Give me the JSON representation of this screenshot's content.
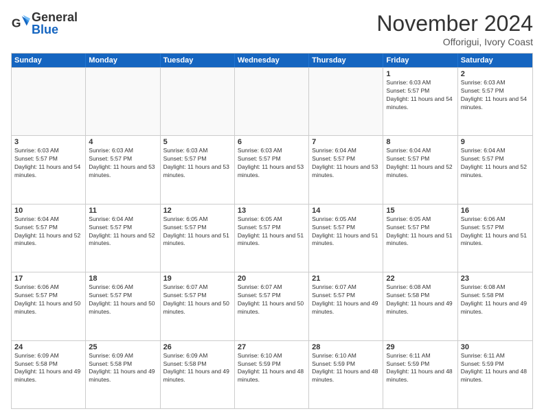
{
  "logo": {
    "general": "General",
    "blue": "Blue"
  },
  "header": {
    "month": "November 2024",
    "location": "Offorigui, Ivory Coast"
  },
  "weekdays": [
    "Sunday",
    "Monday",
    "Tuesday",
    "Wednesday",
    "Thursday",
    "Friday",
    "Saturday"
  ],
  "weeks": [
    [
      {
        "day": "",
        "info": ""
      },
      {
        "day": "",
        "info": ""
      },
      {
        "day": "",
        "info": ""
      },
      {
        "day": "",
        "info": ""
      },
      {
        "day": "",
        "info": ""
      },
      {
        "day": "1",
        "info": "Sunrise: 6:03 AM\nSunset: 5:57 PM\nDaylight: 11 hours and 54 minutes."
      },
      {
        "day": "2",
        "info": "Sunrise: 6:03 AM\nSunset: 5:57 PM\nDaylight: 11 hours and 54 minutes."
      }
    ],
    [
      {
        "day": "3",
        "info": "Sunrise: 6:03 AM\nSunset: 5:57 PM\nDaylight: 11 hours and 54 minutes."
      },
      {
        "day": "4",
        "info": "Sunrise: 6:03 AM\nSunset: 5:57 PM\nDaylight: 11 hours and 53 minutes."
      },
      {
        "day": "5",
        "info": "Sunrise: 6:03 AM\nSunset: 5:57 PM\nDaylight: 11 hours and 53 minutes."
      },
      {
        "day": "6",
        "info": "Sunrise: 6:03 AM\nSunset: 5:57 PM\nDaylight: 11 hours and 53 minutes."
      },
      {
        "day": "7",
        "info": "Sunrise: 6:04 AM\nSunset: 5:57 PM\nDaylight: 11 hours and 53 minutes."
      },
      {
        "day": "8",
        "info": "Sunrise: 6:04 AM\nSunset: 5:57 PM\nDaylight: 11 hours and 52 minutes."
      },
      {
        "day": "9",
        "info": "Sunrise: 6:04 AM\nSunset: 5:57 PM\nDaylight: 11 hours and 52 minutes."
      }
    ],
    [
      {
        "day": "10",
        "info": "Sunrise: 6:04 AM\nSunset: 5:57 PM\nDaylight: 11 hours and 52 minutes."
      },
      {
        "day": "11",
        "info": "Sunrise: 6:04 AM\nSunset: 5:57 PM\nDaylight: 11 hours and 52 minutes."
      },
      {
        "day": "12",
        "info": "Sunrise: 6:05 AM\nSunset: 5:57 PM\nDaylight: 11 hours and 51 minutes."
      },
      {
        "day": "13",
        "info": "Sunrise: 6:05 AM\nSunset: 5:57 PM\nDaylight: 11 hours and 51 minutes."
      },
      {
        "day": "14",
        "info": "Sunrise: 6:05 AM\nSunset: 5:57 PM\nDaylight: 11 hours and 51 minutes."
      },
      {
        "day": "15",
        "info": "Sunrise: 6:05 AM\nSunset: 5:57 PM\nDaylight: 11 hours and 51 minutes."
      },
      {
        "day": "16",
        "info": "Sunrise: 6:06 AM\nSunset: 5:57 PM\nDaylight: 11 hours and 51 minutes."
      }
    ],
    [
      {
        "day": "17",
        "info": "Sunrise: 6:06 AM\nSunset: 5:57 PM\nDaylight: 11 hours and 50 minutes."
      },
      {
        "day": "18",
        "info": "Sunrise: 6:06 AM\nSunset: 5:57 PM\nDaylight: 11 hours and 50 minutes."
      },
      {
        "day": "19",
        "info": "Sunrise: 6:07 AM\nSunset: 5:57 PM\nDaylight: 11 hours and 50 minutes."
      },
      {
        "day": "20",
        "info": "Sunrise: 6:07 AM\nSunset: 5:57 PM\nDaylight: 11 hours and 50 minutes."
      },
      {
        "day": "21",
        "info": "Sunrise: 6:07 AM\nSunset: 5:57 PM\nDaylight: 11 hours and 49 minutes."
      },
      {
        "day": "22",
        "info": "Sunrise: 6:08 AM\nSunset: 5:58 PM\nDaylight: 11 hours and 49 minutes."
      },
      {
        "day": "23",
        "info": "Sunrise: 6:08 AM\nSunset: 5:58 PM\nDaylight: 11 hours and 49 minutes."
      }
    ],
    [
      {
        "day": "24",
        "info": "Sunrise: 6:09 AM\nSunset: 5:58 PM\nDaylight: 11 hours and 49 minutes."
      },
      {
        "day": "25",
        "info": "Sunrise: 6:09 AM\nSunset: 5:58 PM\nDaylight: 11 hours and 49 minutes."
      },
      {
        "day": "26",
        "info": "Sunrise: 6:09 AM\nSunset: 5:58 PM\nDaylight: 11 hours and 49 minutes."
      },
      {
        "day": "27",
        "info": "Sunrise: 6:10 AM\nSunset: 5:59 PM\nDaylight: 11 hours and 48 minutes."
      },
      {
        "day": "28",
        "info": "Sunrise: 6:10 AM\nSunset: 5:59 PM\nDaylight: 11 hours and 48 minutes."
      },
      {
        "day": "29",
        "info": "Sunrise: 6:11 AM\nSunset: 5:59 PM\nDaylight: 11 hours and 48 minutes."
      },
      {
        "day": "30",
        "info": "Sunrise: 6:11 AM\nSunset: 5:59 PM\nDaylight: 11 hours and 48 minutes."
      }
    ]
  ]
}
